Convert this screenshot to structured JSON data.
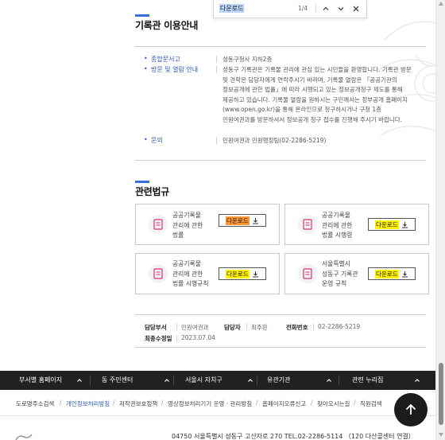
{
  "find_bar": {
    "query": "다운로드",
    "count": "1/4"
  },
  "usage_section": {
    "title": "기록관 이용안내",
    "rows": [
      {
        "term": "종합문서고",
        "desc": "성동구청사 지하2층"
      },
      {
        "term": "방문 및 열람 안내",
        "desc": "성동구 기록관은 기록물 관리에 관심 있는 시민들을 환영합니다. 기록관 방문 및 견학은 담당자에게 연락주시기 바라며, 기록물 열람은 「공공기관의 정보공개에 관한 법률」에 따라 시행되고 있는 정보공개청구 제도를 통해 제공하고 있습니다. 기록물 열람을 원하시는 구민께서는 정부공개 홈페이지(www.open.go.kr)을 통해 온라인으로 청구하시거나 구청 1층 민원여권과를 방문하셔서 정보공개 청구 접수를 진행해 주시기 바랍니다."
      },
      {
        "term": "문의",
        "desc": "민원여권과 민원행정팀(02-2286-5219)"
      }
    ]
  },
  "laws_section": {
    "title": "관련법규",
    "cards": [
      {
        "name": "공공기록물 관리에 관한 법률",
        "button": "다운로드",
        "highlight": "orange"
      },
      {
        "name": "공공기록물 관리에 관한 법률 시행령",
        "button": "다운로드",
        "highlight": "yellow"
      },
      {
        "name": "공공기록물 관리에 관한 법률 시행규칙",
        "button": "다운로드",
        "highlight": "yellow"
      },
      {
        "name": "서울특별시 성동구 기록관 운영 규칙",
        "button": "다운로드",
        "highlight": "yellow"
      }
    ]
  },
  "meta": {
    "dept_label": "담당부서",
    "dept_value": "민원여권과",
    "person_label": "담당자",
    "person_value": "최주환",
    "phone_label": "전화번호",
    "phone_value": "02-2286-5219",
    "updated_label": "최종수정일",
    "updated_value": "2023.07.04"
  },
  "footer_nav": [
    "부서별 홈페이지",
    "동 주민센터",
    "서울시 자치구",
    "유관기관",
    "관련 누리집"
  ],
  "footer_links": [
    "도로명주소검색",
    "개인정보처리방침",
    "저작권보호정책",
    "영상정보처리기기 운영 · 관리방침",
    "홈페이지오류신고",
    "찾아오시는길",
    "직원검색"
  ],
  "address": "04750 서울특별시 성동구 고산자로 270    TEL.02-2286-5114 （120 다산콜센터 연결）",
  "colors": {
    "accent": "#3b6fd8",
    "footer_bg": "#212121",
    "highlight_yellow": "#fff200",
    "highlight_orange": "#ff9632"
  }
}
